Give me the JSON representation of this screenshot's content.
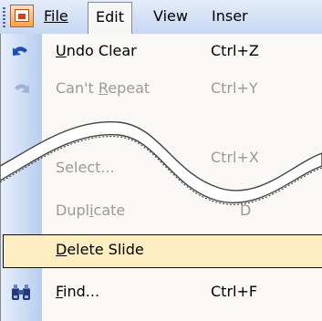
{
  "menubar": {
    "items": [
      "File",
      "Edit",
      "View",
      "Inser"
    ]
  },
  "menu": {
    "undo": {
      "label_pre": "",
      "label_u": "U",
      "label_post": "ndo Clear",
      "shortcut": "Ctrl+Z"
    },
    "repeat": {
      "label_pre": "Can't ",
      "label_u": "R",
      "label_post": "epeat",
      "shortcut": "Ctrl+Y"
    },
    "select": {
      "label": "Select...",
      "shortcut": "Ctrl+X"
    },
    "duplicate": {
      "label_pre": "Dupl",
      "label_u": "i",
      "label_post": "cate",
      "shortcut": "D"
    },
    "delete_slide": {
      "label_pre": "",
      "label_u": "D",
      "label_post": "elete Slide"
    },
    "find": {
      "label_pre": "",
      "label_u": "F",
      "label_post": "ind...",
      "shortcut": "Ctrl+F"
    }
  },
  "colors": {
    "highlight": "#ffeec2",
    "disabled": "#9a9a9a",
    "gutter": "#b8cdee"
  }
}
